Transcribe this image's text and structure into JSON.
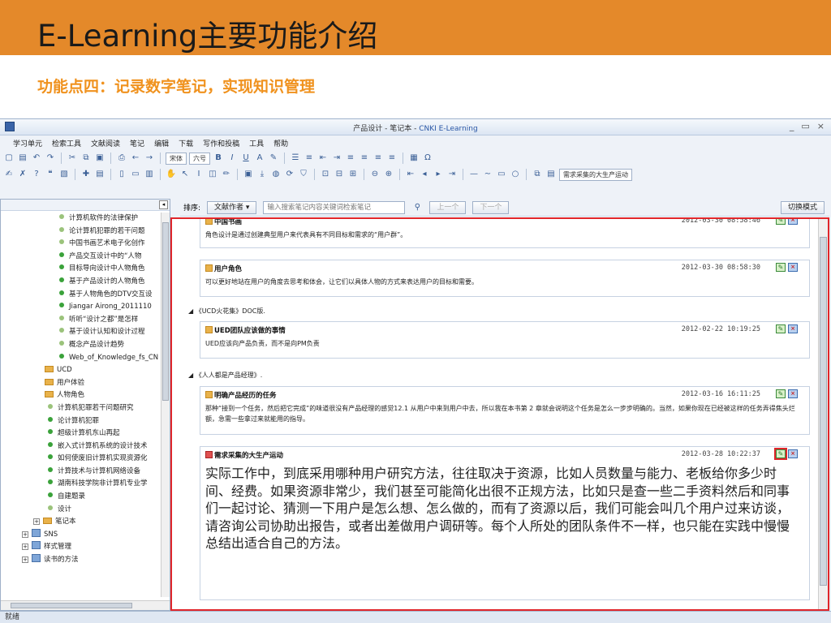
{
  "slide": {
    "title": "E-Learning主要功能介绍",
    "subtitle": "功能点四：记录数字笔记，实现知识管理"
  },
  "window": {
    "title_prefix": "产品设计 - 笔记本 - ",
    "title_brand": "CNKI E-Learning",
    "controls": [
      "_",
      "▭",
      "×"
    ]
  },
  "menu": [
    "学习单元",
    "检索工具",
    "文献阅读",
    "笔记",
    "编辑",
    "下载",
    "写作和投稿",
    "工具",
    "帮助"
  ],
  "toolbar": {
    "font_name": "宋体",
    "font_size": "六号",
    "tag_value": "需求采集的大生产运动"
  },
  "sidebar": {
    "items": [
      {
        "label": "计算机软件的法律保护",
        "kind": "dot-light"
      },
      {
        "label": "论计算机犯罪的若干问题",
        "kind": "dot-light"
      },
      {
        "label": "中国书画艺术电子化创作",
        "kind": "dot-light"
      },
      {
        "label": "产品交互设计中的“人物",
        "kind": "dot-green"
      },
      {
        "label": "目标导向设计中人物角色",
        "kind": "dot-green"
      },
      {
        "label": "基于产品设计的人物角色",
        "kind": "dot-green"
      },
      {
        "label": "基于人物角色的DTV交互设",
        "kind": "dot-green"
      },
      {
        "label": "Jiangar Airong_2011110",
        "kind": "dot-green"
      },
      {
        "label": "听听“设计之都”是怎样",
        "kind": "dot-light"
      },
      {
        "label": "基于设计认知和设计过程",
        "kind": "dot-light"
      },
      {
        "label": "概念产品设计趋势",
        "kind": "dot-light"
      },
      {
        "label": "Web_of_Knowledge_fs_CN",
        "kind": "dot-green"
      },
      {
        "label": "UCD",
        "kind": "folder"
      },
      {
        "label": "用户体验",
        "kind": "folder"
      },
      {
        "label": "人物角色",
        "kind": "folder"
      },
      {
        "label": "计算机犯罪若干问题研究",
        "kind": "dot-light"
      },
      {
        "label": "论计算机犯罪",
        "kind": "dot-green"
      },
      {
        "label": "超级计算机东山再起",
        "kind": "dot-green"
      },
      {
        "label": "嵌入式计算机系统的设计技术",
        "kind": "dot-green"
      },
      {
        "label": "如何使废旧计算机实现资源化",
        "kind": "dot-green"
      },
      {
        "label": "计算技术与计算机网络设备",
        "kind": "dot-green"
      },
      {
        "label": "湖南科技学院非计算机专业学",
        "kind": "dot-green"
      },
      {
        "label": "自建题录",
        "kind": "dot-green"
      },
      {
        "label": "设计",
        "kind": "dot-light"
      },
      {
        "label": "笔记本",
        "kind": "folder-exp"
      },
      {
        "label": "SNS",
        "kind": "book"
      },
      {
        "label": "样式管理",
        "kind": "book"
      },
      {
        "label": "读书的方法",
        "kind": "book"
      }
    ]
  },
  "notes_toolbar": {
    "sort_label": "排序:",
    "sort_value": "文献作者",
    "search_placeholder": "输入搜索笔记内容关键词检索笔记",
    "prev": "上一个",
    "next": "下一个",
    "switch_mode": "切换模式"
  },
  "notes": [
    {
      "title": "中国书画",
      "time": "2012-03-30 08:58:46",
      "body": "角色设计是通过创建典型用户来代表具有不同目标和需求的“用户群”。"
    },
    {
      "title": "用户角色",
      "time": "2012-03-30 08:58:30",
      "body": "可以更好地站在用户的角度去思考和体会，让它们以具体人物的方式来表达用户的目标和需要。"
    },
    {
      "group": "《UCD火花集》DOC版."
    },
    {
      "title": "UED团队应该做的事情",
      "time": "2012-02-22 10:19:25",
      "body": "UED应该向产品负责，而不是向PM负责"
    },
    {
      "group": "《人人都是产品经理》."
    },
    {
      "title": "明确产品经历的任务",
      "time": "2012-03-16 16:11:25",
      "body": "那种“接到一个任务，然后把它完成”的味道很没有产品经理的感觉12.1 从用户中来到用户中去，所以我在本书第 2 章就会说明这个任务是怎么一步步明确的。当然，如果你现在已经被这样的任务弄得焦头烂额，急需一些拿过来就能用的指导。"
    },
    {
      "title": "需求采集的大生产运动",
      "time": "2012-03-28 10:22:37",
      "body": "实际工作中，到底采用哪种用户研究方法，往往取决于资源，比如人员数量与能力、老板给你多少时间、经费。如果资源非常少，我们甚至可能简化出很不正规方法，比如只是查一些二手资料然后和同事们一起讨论、猜测一下用户是怎么想、怎么做的，而有了资源以后，我们可能会叫几个用户过来访谈，请咨询公司协助出报告，或者出差做用户调研等。每个人所处的团队条件不一样，也只能在实践中慢慢总结出适合自己的方法。"
    }
  ],
  "status": "就绪",
  "colors": {
    "accent": "#e4892a",
    "highlight": "#e0262b",
    "subtitle": "#f0921e"
  }
}
